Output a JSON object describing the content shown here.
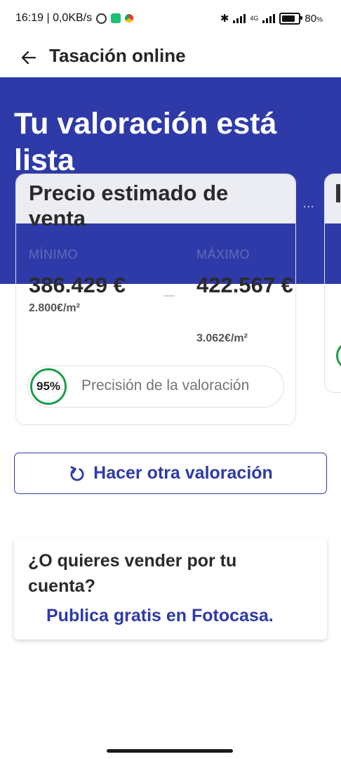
{
  "status_bar": {
    "time_info": "16:19 | 0,0KB/s",
    "network": "4G",
    "battery_percent": "80",
    "battery_level": 0.8
  },
  "app_bar": {
    "title": "Tasación online"
  },
  "hero": {
    "title": "Tu valoración está lista"
  },
  "estimate_card": {
    "title": "Precio estimado de venta",
    "min_label": "MÍNIMO",
    "min_value": "386.429 €",
    "min_per_m2": "2.800€/m²",
    "max_label": "MÁXIMO",
    "max_value": "422.567 €",
    "max_per_m2": "3.062€/m²",
    "precision_percent": "95%",
    "precision_label": "Precisión de la valoración"
  },
  "peek_card": {
    "dots": "..."
  },
  "actions": {
    "redo_label": "Hacer otra valoración"
  },
  "sell_card": {
    "question": "¿O quieres vender por tu cuenta?",
    "link": "Publica gratis en Fotocasa."
  },
  "colors": {
    "brand": "#2e3aa8",
    "accent_green": "#1a9e49"
  }
}
